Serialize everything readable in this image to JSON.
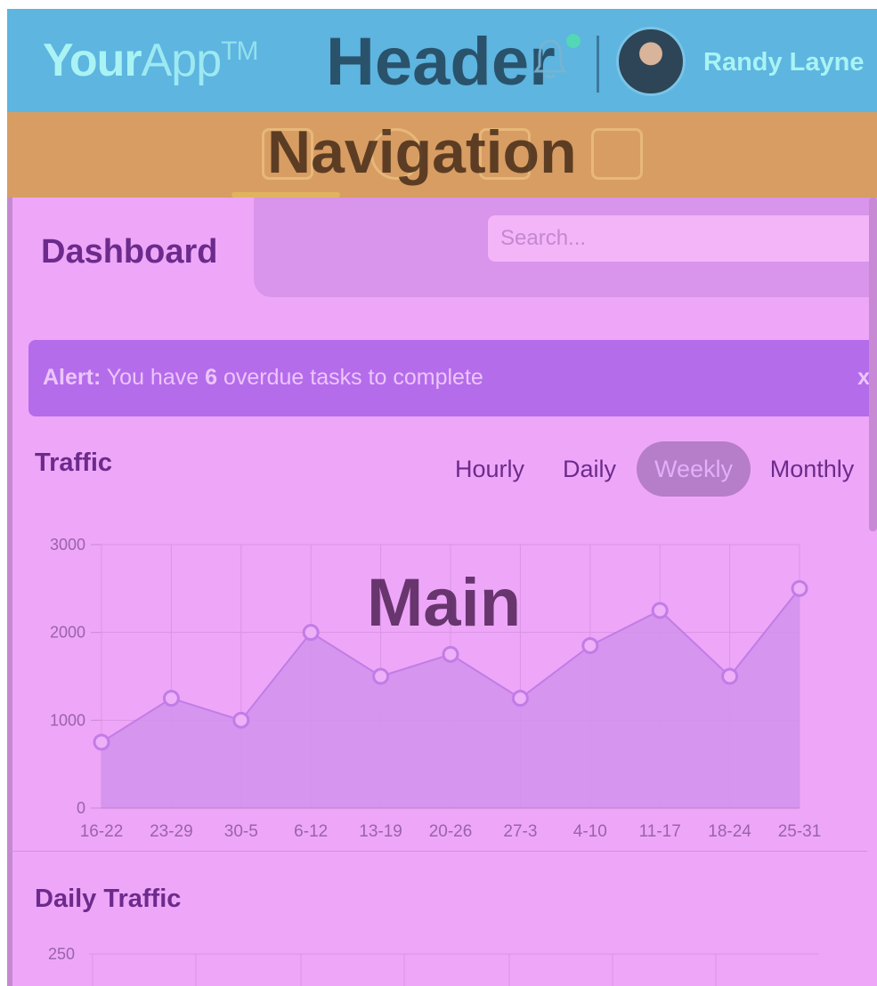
{
  "header": {
    "logo_bold": "Your",
    "logo_light": "App",
    "logo_tm": "TM",
    "overlay_label": "Header",
    "user_name": "Randy Layne",
    "bell_icon": "bell-icon",
    "accent": "#5db5e0"
  },
  "nav": {
    "overlay_label": "Navigation",
    "icons": [
      "calendar-icon",
      "user-icon",
      "chart-icon",
      "settings-icon"
    ],
    "accent": "#d89d63"
  },
  "main": {
    "title": "Dashboard",
    "search": {
      "placeholder": "Search..."
    },
    "alert": {
      "label": "Alert:",
      "before": "You have",
      "count": "6",
      "after": "overdue tasks to complete",
      "close": "x"
    },
    "traffic": {
      "title": "Traffic",
      "tabs": [
        "Hourly",
        "Daily",
        "Weekly",
        "Monthly"
      ],
      "active_tab": "Weekly",
      "overlay_label": "Main"
    },
    "daily_traffic": {
      "title": "Daily Traffic",
      "y_top_label": "250"
    },
    "accent": "#eea7f8"
  },
  "chart_data": [
    {
      "type": "area",
      "x": [
        "16-22",
        "23-29",
        "30-5",
        "6-12",
        "13-19",
        "20-26",
        "27-3",
        "4-10",
        "11-17",
        "18-24",
        "25-31"
      ],
      "values": [
        750,
        1250,
        1000,
        2000,
        1500,
        1750,
        1250,
        1850,
        2250,
        1500,
        2500
      ],
      "ylim": [
        0,
        3000
      ],
      "yticks": [
        "0",
        "1000",
        "2000",
        "3000"
      ],
      "grid": true,
      "title": "",
      "xlabel": "",
      "ylabel": "",
      "line_color": "#c27ce6",
      "fill_color": "#d394ec"
    }
  ]
}
